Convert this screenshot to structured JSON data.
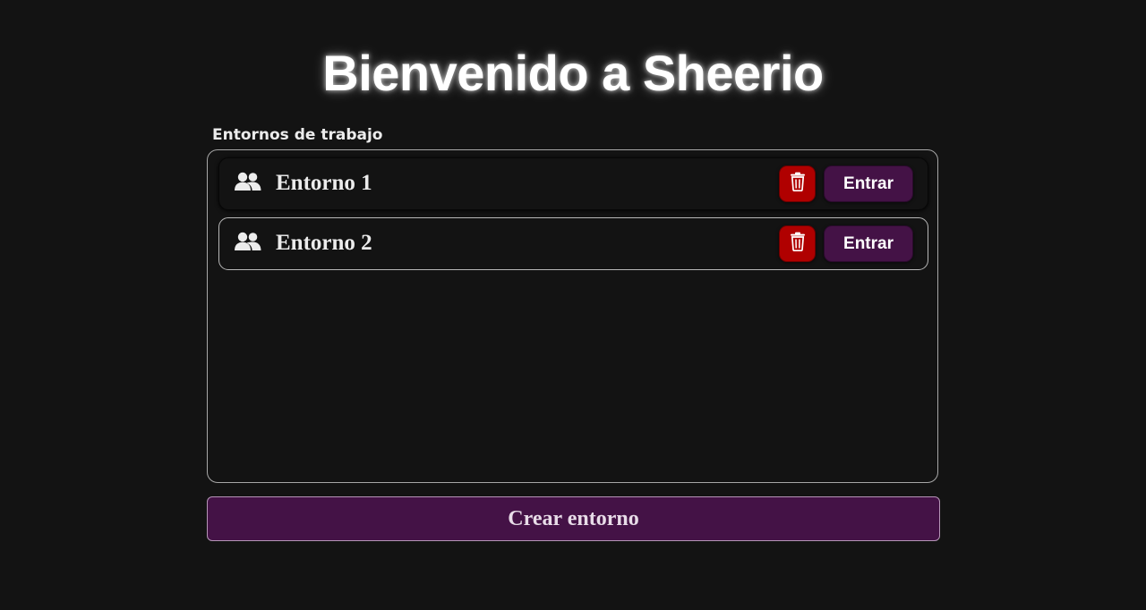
{
  "header": {
    "title": "Bienvenido a Sheerio"
  },
  "workspaces": {
    "section_label": "Entornos de trabajo",
    "items": [
      {
        "name": "Entorno 1",
        "icon": "users-icon",
        "delete_icon": "trash-icon",
        "enter_label": "Entrar"
      },
      {
        "name": "Entorno 2",
        "icon": "users-icon",
        "delete_icon": "trash-icon",
        "enter_label": "Entrar"
      }
    ]
  },
  "actions": {
    "create_label": "Crear entorno"
  },
  "colors": {
    "background": "#131313",
    "accent_purple": "#441246",
    "delete_red": "#b00000",
    "text": "#ececec"
  }
}
